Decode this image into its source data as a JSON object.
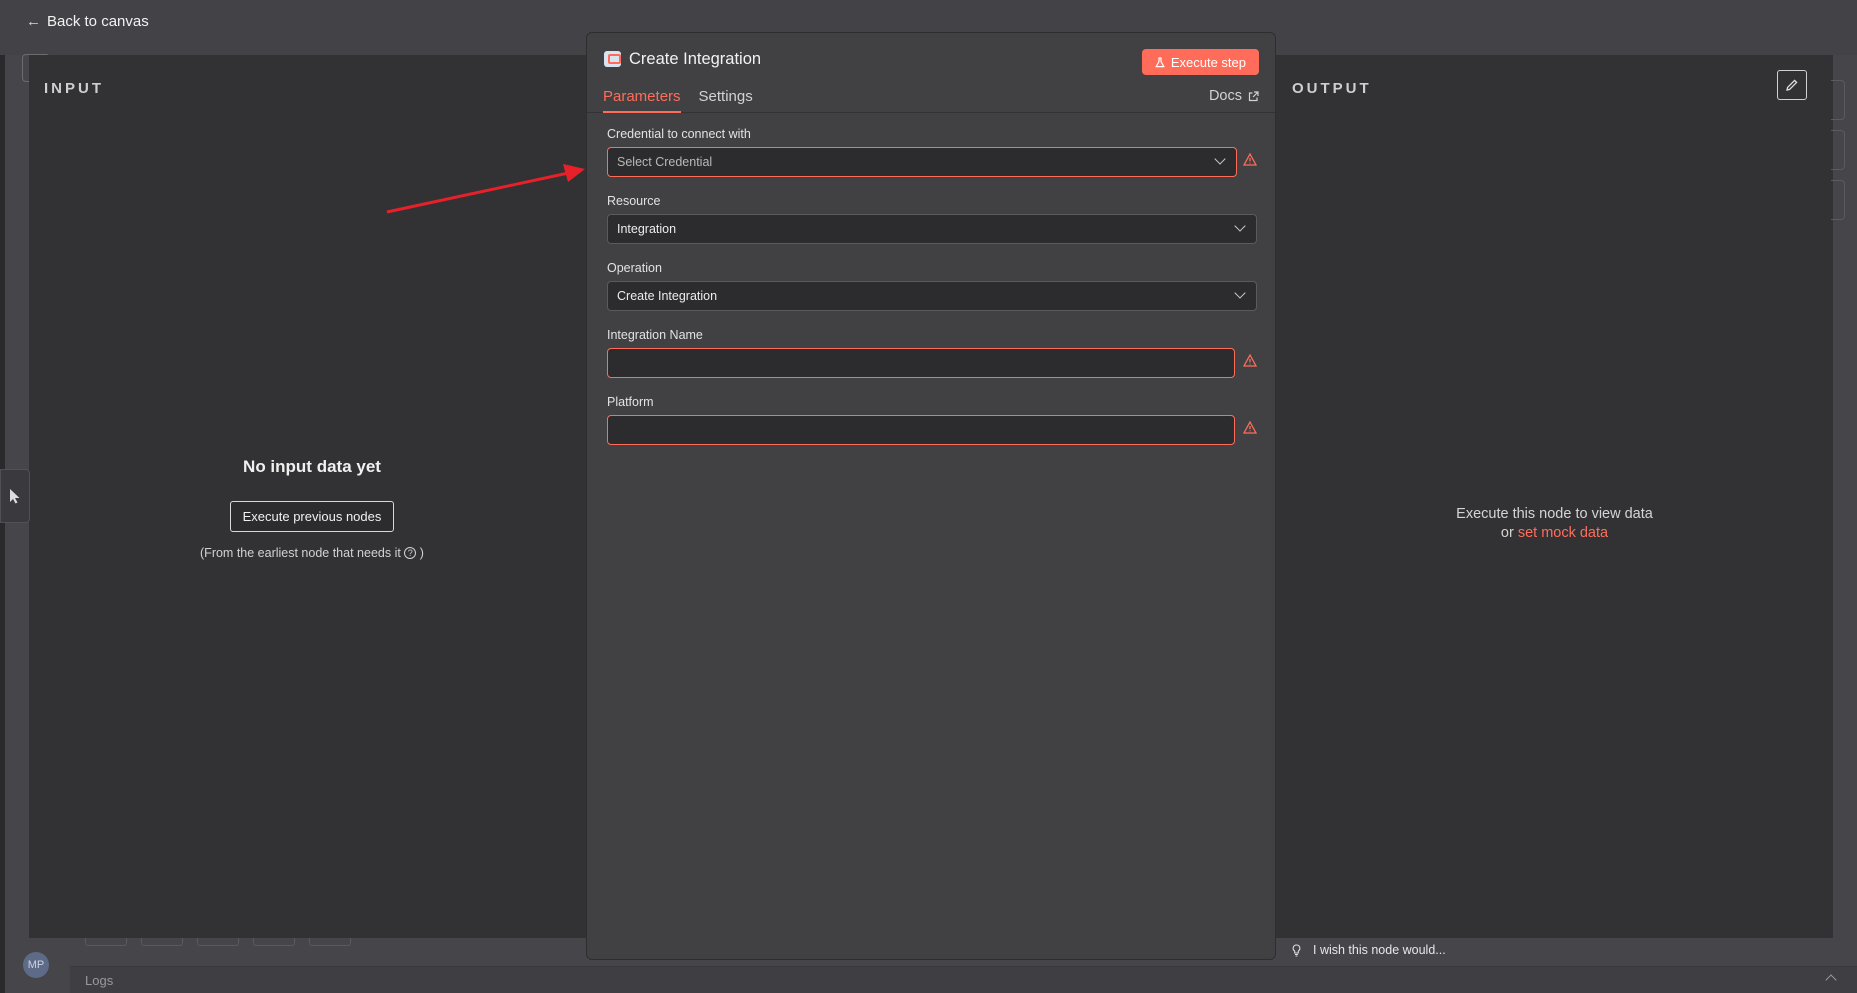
{
  "header": {
    "back_label": "Back to canvas"
  },
  "input_panel": {
    "heading": "INPUT",
    "empty_title": "No input data yet",
    "execute_previous_label": "Execute previous nodes",
    "hint_prefix": "(From the earliest node that needs it",
    "hint_suffix": ")"
  },
  "output_panel": {
    "heading": "OUTPUT",
    "empty_line1": "Execute this node to view data",
    "empty_or": "or",
    "mock_link": "set mock data"
  },
  "dialog": {
    "title": "Create Integration",
    "execute_step_label": "Execute step",
    "tabs": [
      {
        "label": "Parameters",
        "active": true
      },
      {
        "label": "Settings",
        "active": false
      }
    ],
    "docs_label": "Docs",
    "fields": {
      "credential": {
        "label": "Credential to connect with",
        "placeholder": "Select Credential",
        "error": true
      },
      "resource": {
        "label": "Resource",
        "value": "Integration"
      },
      "operation": {
        "label": "Operation",
        "value": "Create Integration"
      },
      "integration_name": {
        "label": "Integration Name",
        "value": "",
        "error": true
      },
      "platform": {
        "label": "Platform",
        "value": "",
        "error": true
      }
    }
  },
  "footer": {
    "wish_label": "I wish this node would...",
    "logs_label": "Logs",
    "avatar_initials": "MP"
  },
  "colors": {
    "accent": "#ff6d5a",
    "panel_bg": "#323234",
    "dialog_bg": "#414144",
    "annotation_arrow": "#e8202a"
  }
}
